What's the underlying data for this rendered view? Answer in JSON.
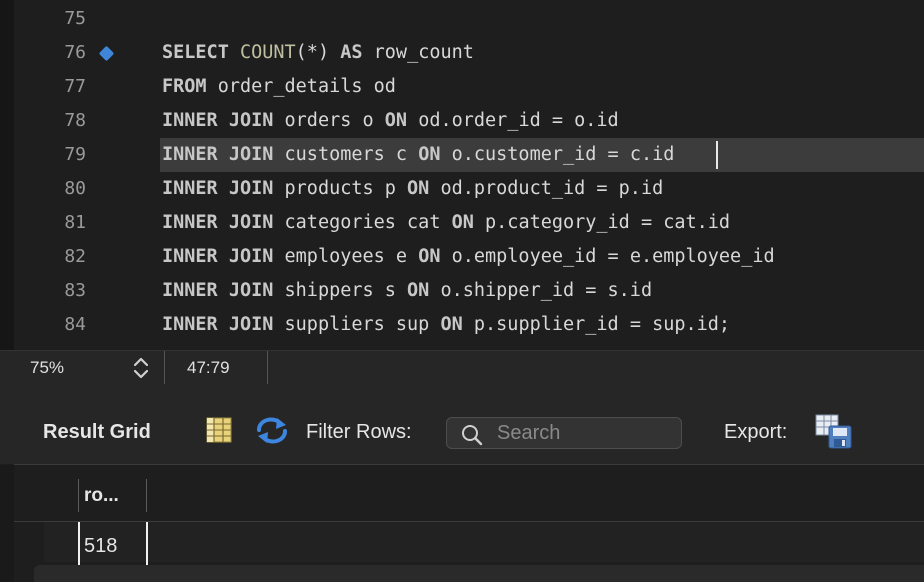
{
  "editor": {
    "lines": [
      {
        "num": "75",
        "tokens": []
      },
      {
        "num": "76",
        "marker": true,
        "tokens": [
          {
            "t": "SELECT",
            "c": "kw"
          },
          {
            "t": " "
          },
          {
            "t": "COUNT",
            "c": "fn"
          },
          {
            "t": "(*) "
          },
          {
            "t": "AS",
            "c": "kw"
          },
          {
            "t": " row_count"
          }
        ]
      },
      {
        "num": "77",
        "tokens": [
          {
            "t": "FROM",
            "c": "kw"
          },
          {
            "t": " order_details od"
          }
        ]
      },
      {
        "num": "78",
        "tokens": [
          {
            "t": "INNER JOIN",
            "c": "kw"
          },
          {
            "t": " orders o "
          },
          {
            "t": "ON",
            "c": "kw"
          },
          {
            "t": " od.order_id = o.id"
          }
        ]
      },
      {
        "num": "79",
        "current": true,
        "tokens": [
          {
            "t": "INNER JOIN",
            "c": "kw"
          },
          {
            "t": " customers c "
          },
          {
            "t": "ON",
            "c": "kw"
          },
          {
            "t": " o.customer_id = c.id"
          }
        ]
      },
      {
        "num": "80",
        "tokens": [
          {
            "t": "INNER JOIN",
            "c": "kw"
          },
          {
            "t": " products p "
          },
          {
            "t": "ON",
            "c": "kw"
          },
          {
            "t": " od.product_id = p.id"
          }
        ]
      },
      {
        "num": "81",
        "tokens": [
          {
            "t": "INNER JOIN",
            "c": "kw"
          },
          {
            "t": " categories cat "
          },
          {
            "t": "ON",
            "c": "kw"
          },
          {
            "t": " p.category_id = cat.id"
          }
        ]
      },
      {
        "num": "82",
        "tokens": [
          {
            "t": "INNER JOIN",
            "c": "kw"
          },
          {
            "t": " employees e "
          },
          {
            "t": "ON",
            "c": "kw"
          },
          {
            "t": " o.employee_id = e.employee_id"
          }
        ]
      },
      {
        "num": "83",
        "tokens": [
          {
            "t": "INNER JOIN",
            "c": "kw"
          },
          {
            "t": " shippers s "
          },
          {
            "t": "ON",
            "c": "kw"
          },
          {
            "t": " o.shipper_id = s.id"
          }
        ]
      },
      {
        "num": "84",
        "tokens": [
          {
            "t": "INNER JOIN",
            "c": "kw"
          },
          {
            "t": " suppliers sup "
          },
          {
            "t": "ON",
            "c": "kw"
          },
          {
            "t": " p.supplier_id = sup.id;"
          }
        ]
      }
    ]
  },
  "statusbar": {
    "zoom": "75%",
    "cursor_position": "47:79"
  },
  "result_toolbar": {
    "title": "Result Grid",
    "filter_label": "Filter Rows:",
    "search_placeholder": "Search",
    "export_label": "Export:"
  },
  "result_grid": {
    "columns": [
      "ro..."
    ],
    "rows": [
      [
        "518"
      ]
    ]
  },
  "colors": {
    "breakpoint_marker": "#3f86d9",
    "editor_bg": "#1e1e1e",
    "panel_bg": "#262626",
    "current_line_bg": "#3c3c3c"
  },
  "icons": {
    "grid": "result-grid-toggle-icon",
    "refresh": "refresh-icon",
    "search": "search-icon",
    "export": "export-icon",
    "zoom_stepper": "chevron-updown-icon"
  }
}
